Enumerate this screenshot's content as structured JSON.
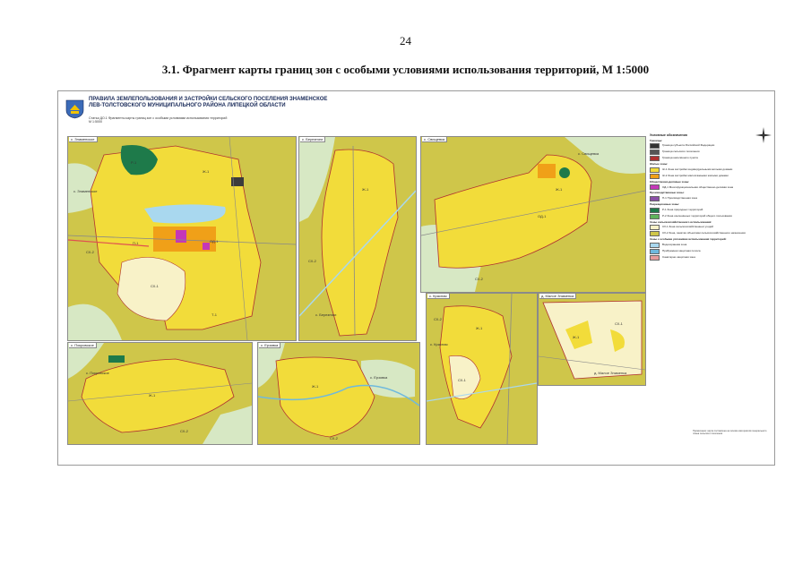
{
  "page_number": "24",
  "heading": "3.1. Фрагмент карты границ зон с особыми условиями использования территорий, М 1:5000",
  "sheet": {
    "title_lines": [
      "ПРАВИЛА ЗЕМЛЕПОЛЬЗОВАНИЯ И ЗАСТРОЙКИ СЕЛЬСКОГО ПОСЕЛЕНИЯ ЗНАМЕНСКОЕ",
      "ЛЕВ-ТОЛСТОВСКОГО МУНИЦИПАЛЬНОГО РАЙОНА ЛИПЕЦКОЙ ОБЛАСТИ"
    ],
    "subtitle_lines": [
      "Статья ДО.1 Фрагменты карты границ зон с особыми условиями использования территорий",
      "М 1:5000"
    ],
    "panels": [
      {
        "label": "с. Знаменское",
        "places": [
          "с. Знаменское"
        ],
        "zones": [
          "Ж-1",
          "ОД-1",
          "П-1",
          "СХ-1",
          "СХ-2",
          "Р-1",
          "Т-1"
        ]
      },
      {
        "label": "с. Березняги",
        "places": [
          "с. Березняги"
        ],
        "zones": [
          "Ж-1",
          "СХ-2"
        ]
      },
      {
        "label": "с. Свищевка",
        "places": [
          "с. Свищевка"
        ],
        "zones": [
          "Ж-1",
          "ОД-1",
          "СХ-2"
        ]
      },
      {
        "label": "с. Красная",
        "places": [
          "с. Красная"
        ],
        "zones": [
          "Ж-1",
          "СХ-1",
          "СХ-2"
        ]
      },
      {
        "label": "д. Малое Знаменка",
        "places": [
          "д. Малое Знаменка"
        ],
        "zones": [
          "Ж-1",
          "СХ-1"
        ]
      },
      {
        "label": "с. Покровское",
        "places": [
          "с. Покровское"
        ],
        "zones": [
          "Ж-1",
          "СХ-2"
        ]
      },
      {
        "label": "с. Ерзовка",
        "places": [
          "с. Ерзовка"
        ],
        "zones": [
          "Ж-1",
          "СХ-2"
        ]
      }
    ]
  },
  "legend": {
    "title": "Условные обозначения",
    "groups": [
      {
        "name": "Границы:",
        "items": [
          {
            "label": "Граница субъекта Российской Федерации",
            "color": "#333333"
          },
          {
            "label": "Граница сельского поселения",
            "color": "#555555"
          },
          {
            "label": "Граница населённого пункта",
            "color": "#b03030"
          }
        ]
      },
      {
        "name": "Жилые зоны:",
        "items": [
          {
            "label": "Ж-1 Зона застройки индивидуальными жилыми домами",
            "color": "#f2dc3a"
          },
          {
            "label": "Ж-2 Зона застройки малоэтажными жилыми домами",
            "color": "#f0a018"
          }
        ]
      },
      {
        "name": "Общественно-деловые зоны:",
        "items": [
          {
            "label": "ОД-1 Многофункциональная общественно-деловая зона",
            "color": "#c437b8"
          }
        ]
      },
      {
        "name": "Производственные зоны:",
        "items": [
          {
            "label": "П-1 Производственная зона",
            "color": "#8a4fa6"
          }
        ]
      },
      {
        "name": "Рекреационные зоны:",
        "items": [
          {
            "label": "Р-1 Зона природных территорий",
            "color": "#1e7a4a"
          },
          {
            "label": "Р-2 Зона озеленённых территорий общего пользования",
            "color": "#5fb35c"
          }
        ]
      },
      {
        "name": "Зоны сельскохозяйственного использования:",
        "items": [
          {
            "label": "СХ-1 Зона сельскохозяйственных угодий",
            "color": "#f8f2c8"
          },
          {
            "label": "СХ-2 Зона, занятая объектами сельскохозяйственного назначения",
            "color": "#cfc64a"
          }
        ]
      },
      {
        "name": "Зоны с особыми условиями использования территорий:",
        "items": [
          {
            "label": "Водоохранная зона",
            "color": "#a9d8ef"
          },
          {
            "label": "Прибрежная защитная полоса",
            "color": "#6fb9dd"
          },
          {
            "label": "Санитарно-защитная зона",
            "color": "#e79c9c"
          }
        ]
      }
    ],
    "footnote": "Примечание: карта составлена на основе материалов генерального плана сельского поселения"
  },
  "colors": {
    "agri": "#cfc64a",
    "residential": "#f2dc3a",
    "residential_dense": "#f0a018",
    "farmland_light": "#f8f2c8",
    "public": "#c437b8",
    "forest": "#1e7a4a",
    "water": "#a9d8ef",
    "meadow": "#d7e8c4",
    "boundary": "#b03030"
  }
}
